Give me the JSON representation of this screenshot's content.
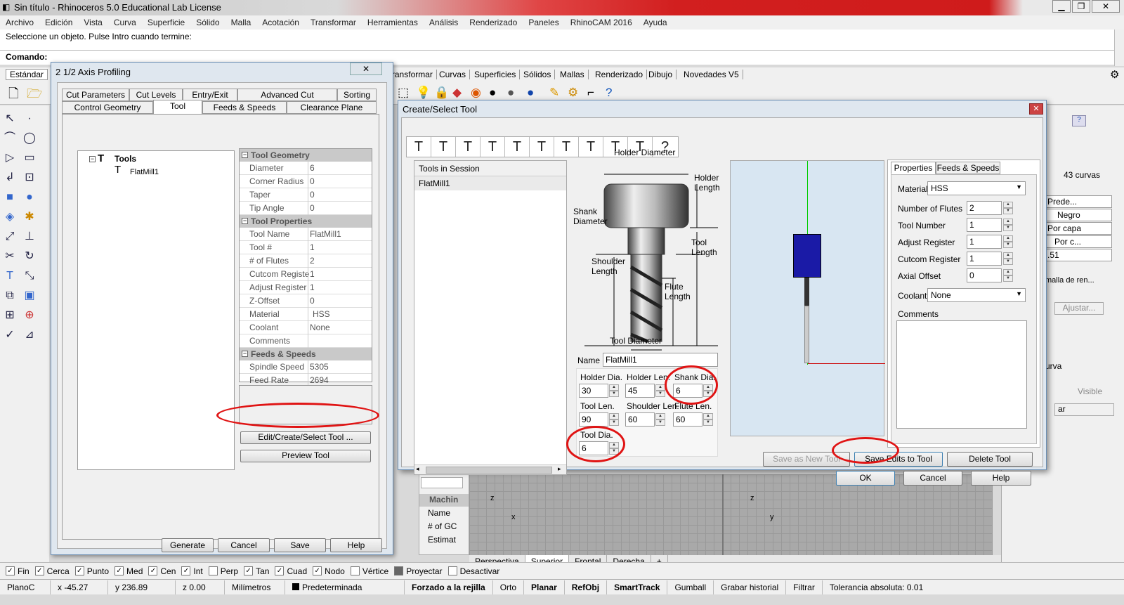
{
  "app": {
    "title": "Sin título - Rhinoceros 5.0 Educational Lab License",
    "win_buttons": [
      "▁",
      "❐",
      "✕"
    ],
    "menu": [
      "Archivo",
      "Edición",
      "Vista",
      "Curva",
      "Superficie",
      "Sólido",
      "Malla",
      "Acotación",
      "Transformar",
      "Herramientas",
      "Análisis",
      "Renderizado",
      "Paneles",
      "RhinoCAM 2016",
      "Ayuda"
    ],
    "prompt": "Seleccione un objeto. Pulse Intro cuando termine:",
    "command_label": "Comando:",
    "tabs": [
      "Estándar",
      "Transformar",
      "Curvas",
      "Superficies",
      "Sólidos",
      "Mallas",
      "Renderizado",
      "Dibujo",
      "Novedades V5"
    ],
    "viewport_tabs": [
      "Perspectiva",
      "Superior",
      "Frontal",
      "Derecha",
      "+"
    ],
    "osnaps": [
      {
        "label": "Fin",
        "checked": true
      },
      {
        "label": "Cerca",
        "checked": true
      },
      {
        "label": "Punto",
        "checked": true
      },
      {
        "label": "Med",
        "checked": true
      },
      {
        "label": "Cen",
        "checked": true
      },
      {
        "label": "Int",
        "checked": true
      },
      {
        "label": "Perp",
        "checked": false
      },
      {
        "label": "Tan",
        "checked": true
      },
      {
        "label": "Cuad",
        "checked": true
      },
      {
        "label": "Nodo",
        "checked": true
      },
      {
        "label": "Vértice",
        "checked": false
      },
      {
        "label": "Proyectar",
        "checked": false
      },
      {
        "label": "Desactivar",
        "checked": false
      }
    ],
    "statusbar": [
      "PlanoC",
      "x -45.27",
      "y 236.89",
      "z 0.00",
      "Milímetros",
      "Predeterminada",
      "Forzado a la rejilla",
      "Orto",
      "Planar",
      "RefObj",
      "SmartTrack",
      "Gumball",
      "Grabar historial",
      "Filtrar",
      "Tolerancia absoluta: 0.01"
    ],
    "right_panel": [
      "43 curvas",
      "Prede...",
      "Negro",
      "Por capa",
      "Por c...",
      ".51",
      "malla de ren...",
      "Ajustar...",
      "urva",
      "Visible",
      "ar"
    ],
    "machin": [
      "Machin",
      "Name",
      "# of GC",
      "Estimat"
    ]
  },
  "profiling": {
    "title": "2 1/2 Axis Profiling",
    "close": "✕",
    "tabs_row1": [
      "Cut Parameters",
      "Cut Levels",
      "Entry/Exit",
      "Advanced Cut Parameters",
      "Sorting"
    ],
    "tabs_row2": [
      "Control Geometry",
      "Tool",
      "Feeds & Speeds",
      "Clearance Plane"
    ],
    "tree_root": "Tools",
    "tree_child": "FlatMill1",
    "sections": {
      "geometry": "Tool Geometry",
      "properties": "Tool Properties",
      "feeds": "Feeds & Speeds"
    },
    "geometry_rows": [
      [
        "Diameter",
        "6"
      ],
      [
        "Corner Radius",
        "0"
      ],
      [
        "Taper",
        "0"
      ],
      [
        "Tip Angle",
        "0"
      ]
    ],
    "property_rows": [
      [
        "Tool Name",
        "FlatMill1"
      ],
      [
        "Tool #",
        "1"
      ],
      [
        "# of Flutes",
        "2"
      ],
      [
        "Cutcom Registe",
        "1"
      ],
      [
        "Adjust Register",
        "1"
      ],
      [
        "Z-Offset",
        "0"
      ],
      [
        "Material",
        "HSS"
      ],
      [
        "Coolant",
        "None"
      ],
      [
        "Comments",
        ""
      ]
    ],
    "feed_rows": [
      [
        "Spindle Speed",
        "5305"
      ],
      [
        "Feed Rate",
        "2694"
      ]
    ],
    "edit_button": "Edit/Create/Select Tool ...",
    "preview_button": "Preview Tool",
    "generate": "Generate",
    "cancel": "Cancel",
    "save": "Save",
    "help": "Help"
  },
  "create_tool": {
    "title": "Create/Select Tool",
    "close": "✕",
    "tool_icons": [
      "T",
      "T",
      "T",
      "T",
      "T",
      "T",
      "T",
      "T",
      "T",
      "T",
      "?"
    ],
    "session_header": "Tools in Session",
    "session_items": [
      "FlatMill1"
    ],
    "diagram_labels": {
      "holder_diameter": "Holder Diameter",
      "holder_length": "Holder\nLength",
      "shank_diameter": "Shank\nDiameter",
      "tool_length": "Tool\nLength",
      "shoulder_length": "Shoulder\nLength",
      "flute_length": "Flute\nLength",
      "tool_diameter": "Tool Diameter"
    },
    "name_label": "Name",
    "name_value": "FlatMill1",
    "dims": [
      {
        "label": "Holder Dia.",
        "value": "30"
      },
      {
        "label": "Holder Len.",
        "value": "45"
      },
      {
        "label": "Shank Dia.",
        "value": "6"
      },
      {
        "label": "Tool Len.",
        "value": "90"
      },
      {
        "label": "Shoulder Len.",
        "value": "60"
      },
      {
        "label": "Flute Len.",
        "value": "60"
      },
      {
        "label": "Tool Dia.",
        "value": "6"
      }
    ],
    "tabs": [
      "Properties",
      "Feeds & Speeds"
    ],
    "material_label": "Material",
    "material_value": "HSS",
    "fields": [
      {
        "label": "Number of Flutes",
        "value": "2"
      },
      {
        "label": "Tool Number",
        "value": "1"
      },
      {
        "label": "Adjust Register",
        "value": "1"
      },
      {
        "label": "Cutcom Register",
        "value": "1"
      },
      {
        "label": "Axial Offset",
        "value": "0"
      }
    ],
    "coolant_label": "Coolant",
    "coolant_value": "None",
    "comments_label": "Comments",
    "save_new": "Save as New Tool",
    "save_edits": "Save Edits to Tool",
    "delete": "Delete Tool",
    "ok": "OK",
    "cancel": "Cancel",
    "help": "Help"
  },
  "colors": {
    "title_red": "#d21f1f",
    "tool_holder_blue": "#1a1aa6",
    "annotation_red": "#e01414",
    "grid_bg": "#d8e6f2"
  }
}
